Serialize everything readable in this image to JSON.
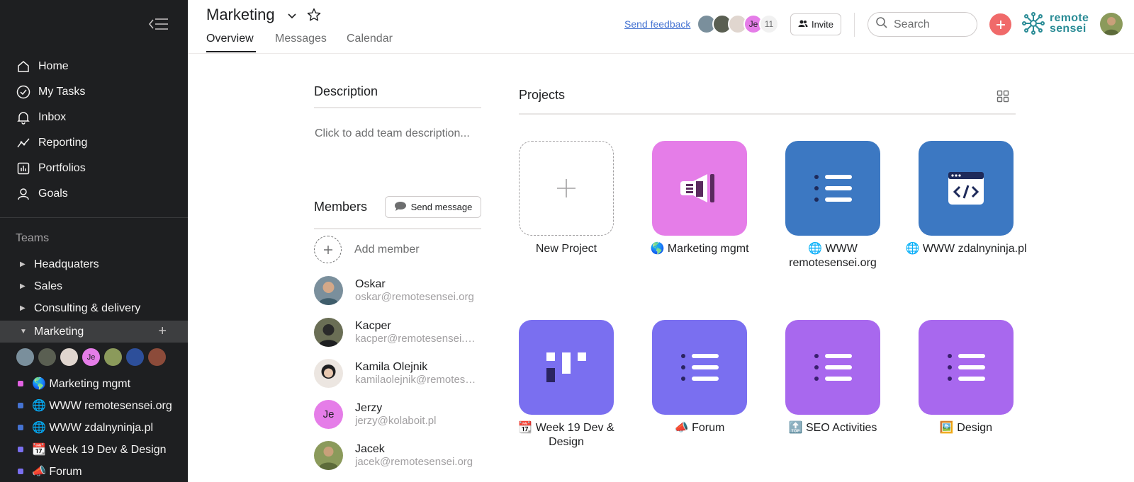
{
  "sidebar": {
    "nav": [
      {
        "label": "Home",
        "icon": "home-icon"
      },
      {
        "label": "My Tasks",
        "icon": "check-circle-icon"
      },
      {
        "label": "Inbox",
        "icon": "bell-icon"
      },
      {
        "label": "Reporting",
        "icon": "line-chart-icon"
      },
      {
        "label": "Portfolios",
        "icon": "bar-chart-icon"
      },
      {
        "label": "Goals",
        "icon": "person-icon"
      }
    ],
    "teams_label": "Teams",
    "teams": [
      {
        "label": "Headquaters",
        "expanded": false
      },
      {
        "label": "Sales",
        "expanded": false
      },
      {
        "label": "Consulting & delivery",
        "expanded": false
      },
      {
        "label": "Marketing",
        "expanded": true
      }
    ],
    "team_member_initials": "Je",
    "projects": [
      {
        "label": "🌎 Marketing mgmt",
        "color": "#e362e3"
      },
      {
        "label": "🌐 WWW remotesensei.org",
        "color": "#4573d2"
      },
      {
        "label": "🌐 WWW zdalnyninja.pl",
        "color": "#4573d2"
      },
      {
        "label": "📆 Week 19 Dev & Design",
        "color": "#7a6ff0"
      },
      {
        "label": "📣 Forum",
        "color": "#7a6ff0"
      }
    ]
  },
  "header": {
    "title": "Marketing",
    "tabs": [
      "Overview",
      "Messages",
      "Calendar"
    ],
    "active_tab": "Overview",
    "feedback": "Send feedback",
    "avatar_initials": "Je",
    "member_count": "11",
    "invite": "Invite",
    "search_placeholder": "Search",
    "logo_line1": "remote",
    "logo_line2": "sensei"
  },
  "description": {
    "title": "Description",
    "placeholder": "Click to add team description..."
  },
  "members": {
    "title": "Members",
    "send_message": "Send message",
    "add_member": "Add member",
    "list": [
      {
        "name": "Oskar",
        "email": "oskar@remotesensei.org"
      },
      {
        "name": "Kacper",
        "email": "kacper@remotesensei.org"
      },
      {
        "name": "Kamila Olejnik",
        "email": "kamilaolejnik@remotesensei.org"
      },
      {
        "name": "Jerzy",
        "email": "jerzy@kolaboit.pl",
        "initials": "Je"
      },
      {
        "name": "Jacek",
        "email": "jacek@remotesensei.org"
      }
    ]
  },
  "projects": {
    "title": "Projects",
    "new_label": "New Project",
    "tiles": [
      {
        "label": "🌎 Marketing mgmt",
        "color": "#e57de8",
        "icon": "megaphone-icon"
      },
      {
        "label": "🌐 WWW remotesensei.org",
        "color": "#3c78c2",
        "icon": "list-icon"
      },
      {
        "label": "🌐 WWW zdalnyninja.pl",
        "color": "#3c78c2",
        "icon": "code-window-icon"
      },
      {
        "label": "📆 Week 19 Dev & Design",
        "color": "#7a6ff0",
        "icon": "board-icon"
      },
      {
        "label": "📣 Forum",
        "color": "#7a6ff0",
        "icon": "list-icon"
      },
      {
        "label": "🔝 SEO Activities",
        "color": "#a868ee",
        "icon": "list-icon"
      },
      {
        "label": "🖼️ Design",
        "color": "#a868ee",
        "icon": "list-icon"
      }
    ]
  }
}
